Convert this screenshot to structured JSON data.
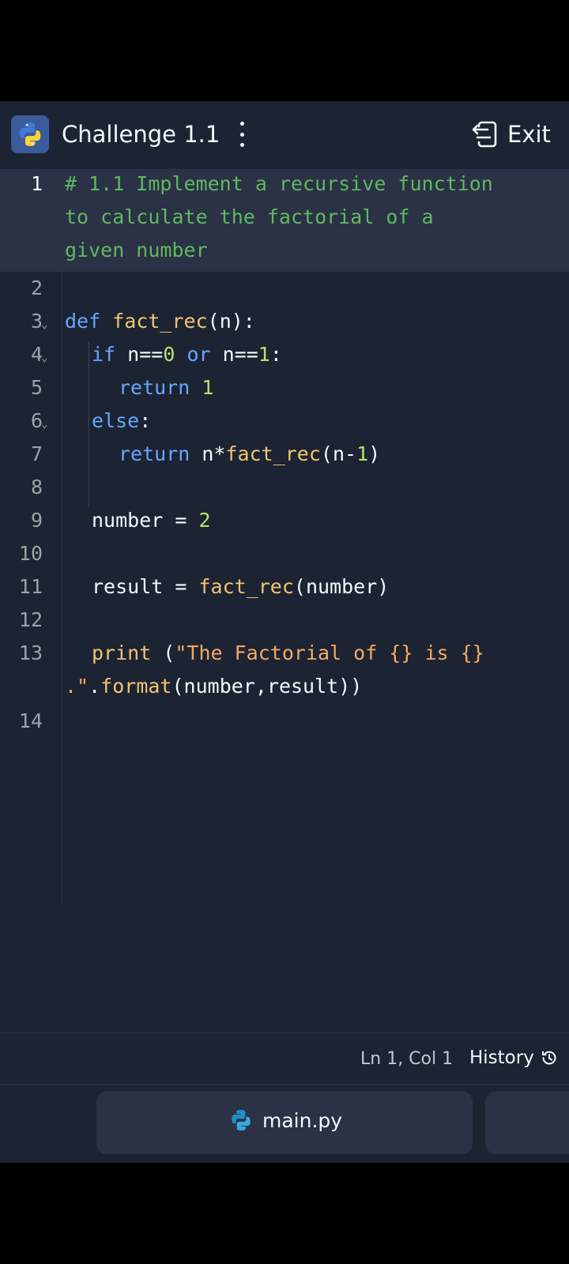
{
  "header": {
    "title": "Challenge 1.1",
    "exit_label": "Exit"
  },
  "editor": {
    "line_numbers": [
      "1",
      "2",
      "3",
      "4",
      "5",
      "6",
      "7",
      "8",
      "9",
      "10",
      "11",
      "12",
      "13",
      "14"
    ],
    "lines": {
      "l1a": "# 1.1 Implement a recursive function",
      "l1b": "to calculate the factorial of a",
      "l1c": "given number",
      "l3_kw": "def",
      "l3_fn": "fact_rec",
      "l3_rest": "(n):",
      "l4_kw": "if",
      "l4_a": "n==",
      "l4_n1": "0",
      "l4_or": "or",
      "l4_b": "n==",
      "l4_n2": "1",
      "l4_c": ":",
      "l5_kw": "return",
      "l5_n": "1",
      "l6_kw": "else",
      "l6_c": ":",
      "l7_kw": "return",
      "l7_a": "n*",
      "l7_fn": "fact_rec",
      "l7_b": "(n-",
      "l7_n": "1",
      "l7_c": ")",
      "l9_a": "number = ",
      "l9_n": "2",
      "l11_a": "result = ",
      "l11_fn": "fact_rec",
      "l11_b": "(number)",
      "l13_fn": "print",
      "l13_a": " (",
      "l13_str": "\"The Factorial of {} is {}",
      "l13b_str": ".\"",
      "l13b_a": ".",
      "l13b_fn": "format",
      "l13b_b": "(number,result))"
    }
  },
  "status": {
    "cursor": "Ln 1, Col 1",
    "history_label": "History"
  },
  "footer": {
    "file_name": "main.py"
  },
  "colors": {
    "background": "#1c2333",
    "comment": "#5fb85f",
    "keyword": "#67a6ff",
    "function": "#f2c46f",
    "number": "#b7e36a",
    "string": "#f5a861"
  },
  "icons": [
    "python-icon",
    "more-vert-icon",
    "exit-icon",
    "chevron-down-icon",
    "history-icon"
  ]
}
